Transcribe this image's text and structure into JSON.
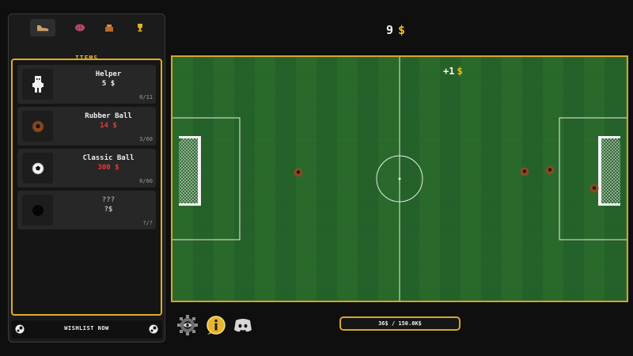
{
  "money": {
    "value": "9",
    "currency": "$"
  },
  "sidebar": {
    "tabs": [
      {
        "name": "tab-items",
        "icon": "soccer-cleat-icon",
        "active": true
      },
      {
        "name": "tab-brain",
        "icon": "brain-icon",
        "active": false
      },
      {
        "name": "tab-stadium",
        "icon": "stadium-icon",
        "active": false
      },
      {
        "name": "tab-trophy",
        "icon": "trophy-icon",
        "active": false
      }
    ],
    "title": "ITEMS",
    "items": [
      {
        "name": "Helper",
        "price": "5 $",
        "count": "0/11",
        "icon": "helper-figure-icon",
        "affordable": true
      },
      {
        "name": "Rubber Ball",
        "price": "14 $",
        "count": "3/60",
        "icon": "rubber-ball-icon",
        "affordable": false
      },
      {
        "name": "Classic Ball",
        "price": "300 $",
        "count": "0/60",
        "icon": "classic-ball-icon",
        "affordable": false
      },
      {
        "name": "???",
        "price": "?$",
        "count": "?/?",
        "icon": "locked-ball-icon",
        "affordable": true
      }
    ],
    "wishlist": {
      "label": "WISHLIST NOW",
      "icon": "steam-icon"
    }
  },
  "field": {
    "popup": {
      "text": "+1",
      "currency": "$"
    },
    "balls": 4
  },
  "bottom": {
    "icons": [
      "settings-gear-icon",
      "info-icon",
      "discord-icon"
    ],
    "progress": {
      "label": "36$ / 150.0K$",
      "fraction": 0.00024
    }
  },
  "colors": {
    "accent": "#e0ac25",
    "money": "#f1c21b",
    "expensive": "#e63b3b",
    "pitch": "#2a6b2c"
  }
}
